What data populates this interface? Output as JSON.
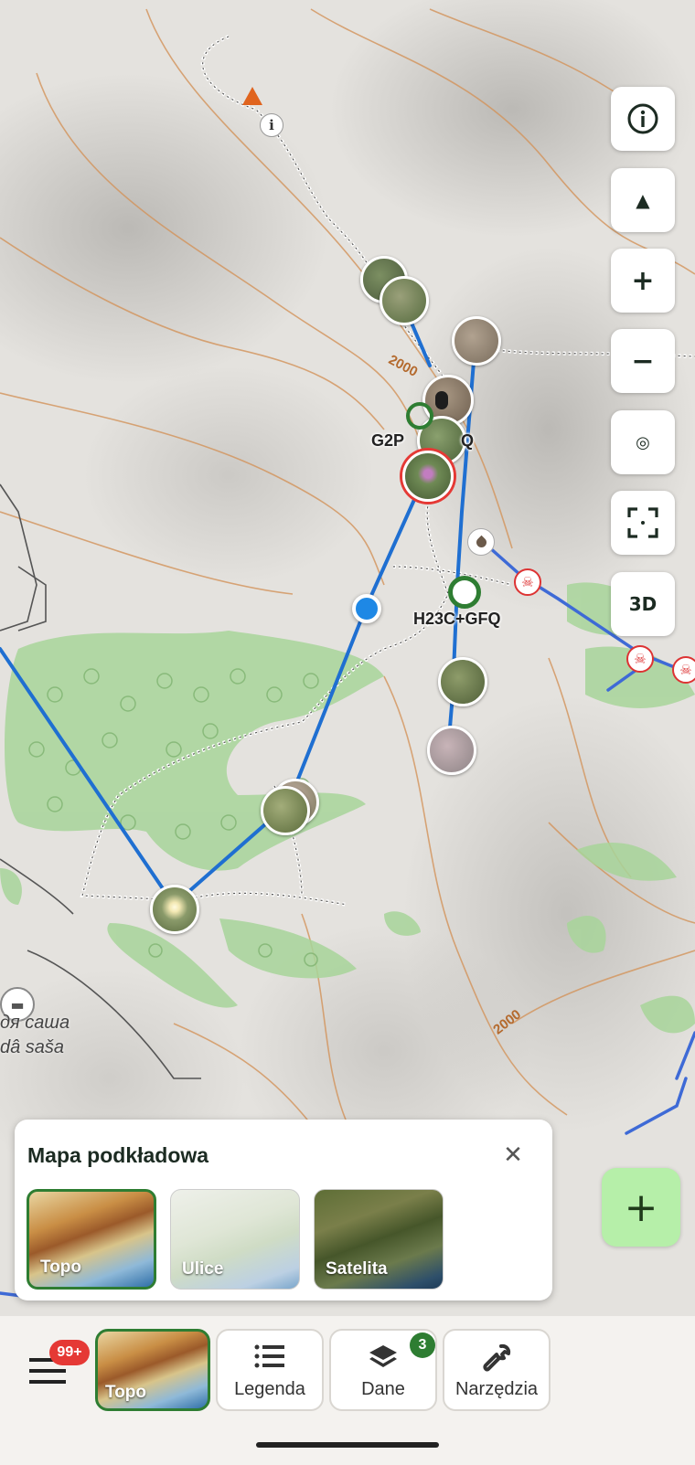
{
  "map": {
    "labels": {
      "plus_code_1": "G2P",
      "plus_code_1_suffix": "Q",
      "plus_code_2": "H23C+GFQ",
      "place_cyrillic": "дя саша",
      "place_latin": "dâ saša",
      "contour_1": "2000",
      "contour_2": "2000"
    }
  },
  "controls": {
    "info": "info-icon",
    "north": "▲",
    "zoom_in": "+",
    "zoom_out": "−",
    "locate": "◎",
    "fullscreen": "focus-frame-icon",
    "three_d": "3D"
  },
  "fab": {
    "label": "+"
  },
  "basemap_panel": {
    "title": "Mapa podkładowa",
    "close": "✕",
    "options": [
      {
        "label": "Topo",
        "selected": true
      },
      {
        "label": "Ulice",
        "selected": false
      },
      {
        "label": "Satelita",
        "selected": false
      }
    ]
  },
  "bottom_nav": {
    "menu_badge": "99+",
    "topo_label": "Topo",
    "legend_label": "Legenda",
    "data_label": "Dane",
    "data_badge": "3",
    "tools_label": "Narzędzia"
  },
  "colors": {
    "route": "#1f6fd1",
    "accent_green": "#2e7d32",
    "fab_green": "#b6efa9",
    "badge_red": "#e53935"
  }
}
